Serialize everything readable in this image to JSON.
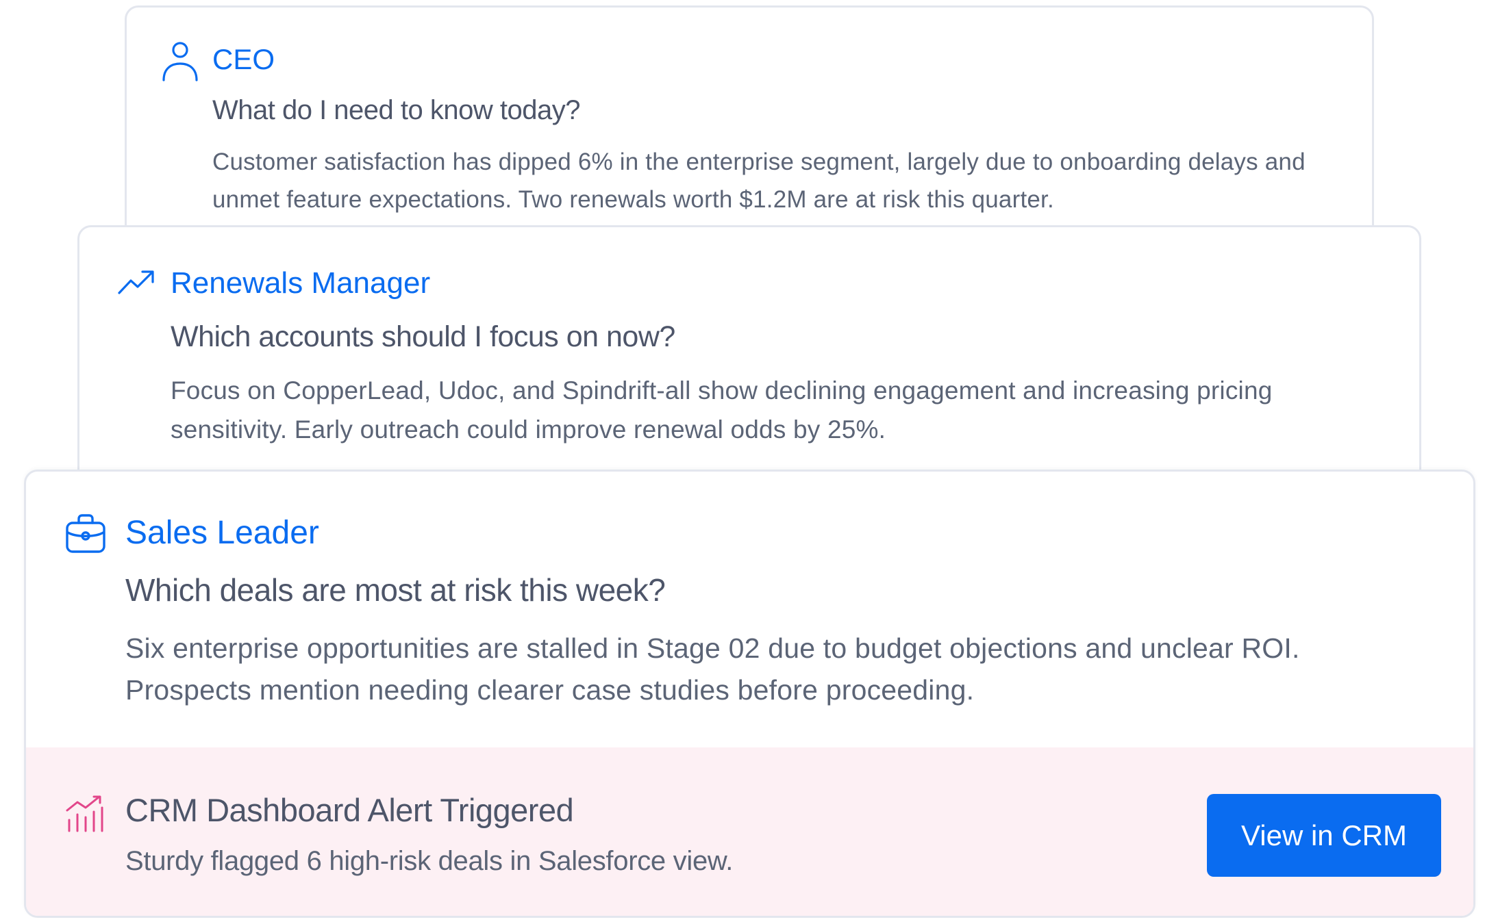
{
  "colors": {
    "accent": "#0a6cf0",
    "alert_background": "#fdf0f4",
    "alert_icon": "#e2468a",
    "text_heading": "#4d5569",
    "text_body": "#5b6476"
  },
  "cards": [
    {
      "role": "CEO",
      "icon": "user-icon",
      "question": "What do I need to know today?",
      "answer": "Customer satisfaction has dipped 6% in the enterprise segment, largely due to onboarding delays and unmet feature expectations. Two renewals worth $1.2M are at risk this quarter."
    },
    {
      "role": "Renewals Manager",
      "icon": "trending-up-icon",
      "question": "Which accounts should I focus on now?",
      "answer": "Focus on CopperLead, Udoc, and Spindrift-all show declining engagement and increasing pricing sensitivity. Early outreach could improve renewal odds by 25%."
    },
    {
      "role": "Sales Leader",
      "icon": "briefcase-icon",
      "question": "Which deals are most at risk this week?",
      "answer": "Six enterprise opportunities are stalled in Stage 02 due to budget objections and unclear ROI. Prospects mention needing clearer case studies before proceeding."
    }
  ],
  "alert": {
    "icon": "chart-trend-icon",
    "title": "CRM Dashboard Alert Triggered",
    "subtitle": "Sturdy flagged 6 high-risk deals in Salesforce view.",
    "button_label": "View in CRM"
  }
}
